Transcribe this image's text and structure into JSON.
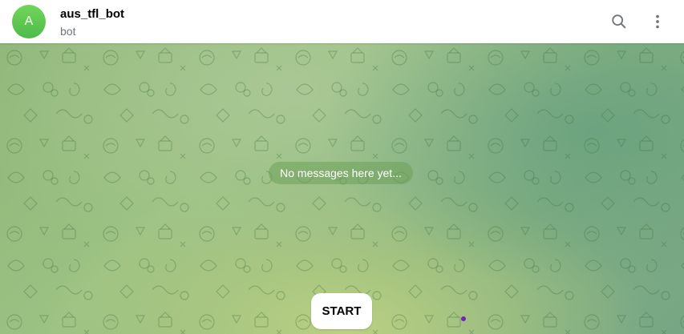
{
  "header": {
    "avatar_letter": "A",
    "title": "aus_tfl_bot",
    "subtitle": "bot",
    "search_icon": "search-icon",
    "menu_icon": "more-vertical-icon"
  },
  "chat": {
    "empty_text": "No messages here yet...",
    "start_label": "START"
  },
  "colors": {
    "avatar": "#5cc74f",
    "subtitle": "#707579",
    "background": "#93bb7f"
  }
}
